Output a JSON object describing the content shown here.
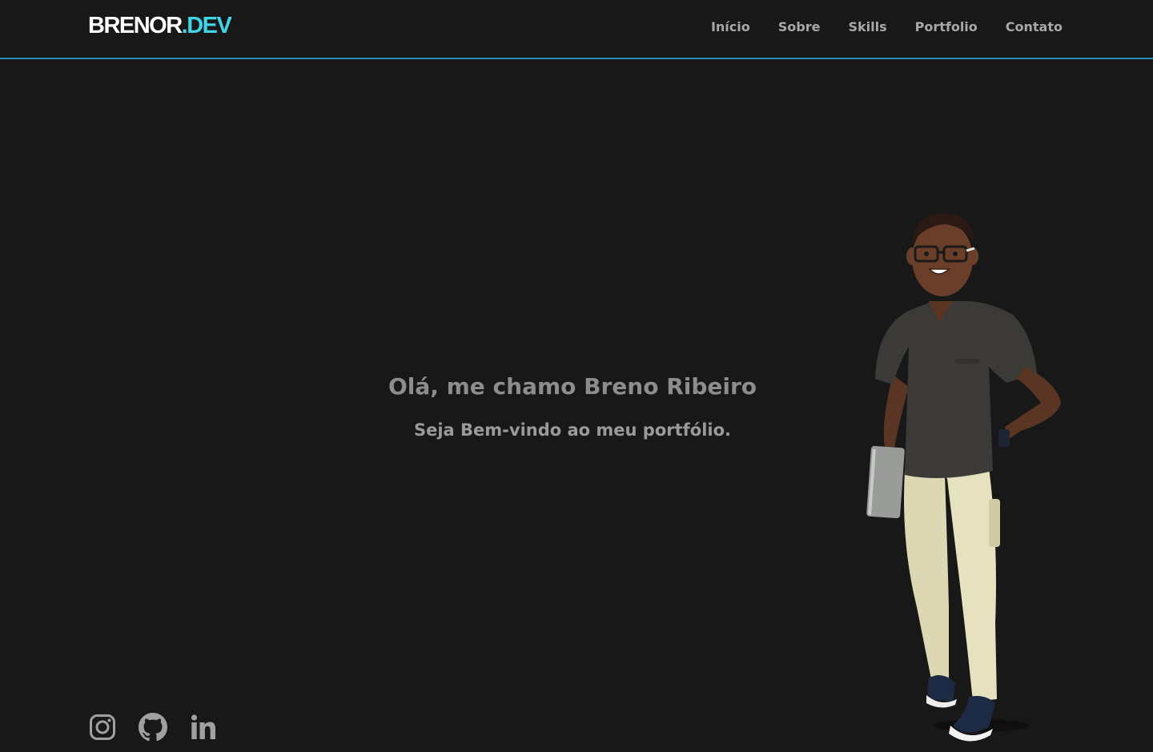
{
  "header": {
    "logo": {
      "brand": "BRENOR",
      "tld": ".DEV"
    },
    "nav": [
      {
        "label": "Início"
      },
      {
        "label": "Sobre"
      },
      {
        "label": "Skills"
      },
      {
        "label": "Portfolio"
      },
      {
        "label": "Contato"
      }
    ]
  },
  "hero": {
    "title": "Olá, me chamo Breno Ribeiro",
    "subtitle": "Seja Bem-vindo ao meu portfólio."
  },
  "socials": [
    {
      "icon": "instagram-icon"
    },
    {
      "icon": "github-icon"
    },
    {
      "icon": "linkedin-icon"
    }
  ],
  "colors": {
    "background": "#181818",
    "accent": "#40d6e6",
    "header_border": "#1f8fb3",
    "nav_text": "#a8a8a8",
    "hero_text": "#8d8d8d"
  }
}
